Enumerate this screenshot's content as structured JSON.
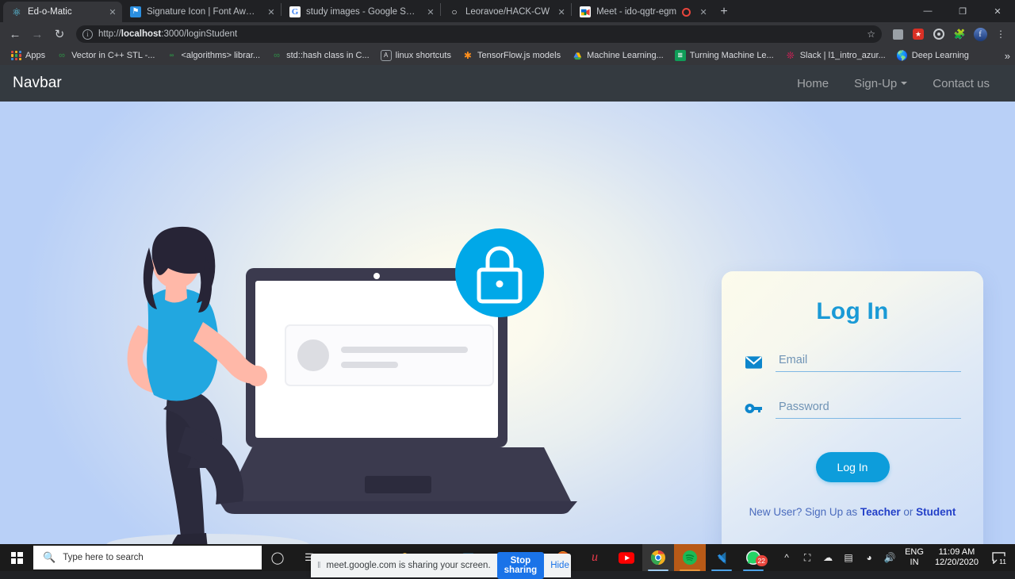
{
  "browser": {
    "tabs": [
      {
        "title": "Ed-o-Matic",
        "favicon": "react-icon",
        "active": true,
        "recording": false
      },
      {
        "title": "Signature Icon | Font Awesome",
        "favicon": "fontawesome-icon",
        "active": false,
        "recording": false
      },
      {
        "title": "study images - Google Search",
        "favicon": "google-icon",
        "active": false,
        "recording": false
      },
      {
        "title": "Leoravoe/HACK-CW",
        "favicon": "github-icon",
        "active": false,
        "recording": false
      },
      {
        "title": "Meet - ido-qgtr-egm",
        "favicon": "google-meet-icon",
        "active": false,
        "recording": true
      }
    ],
    "new_tab_label": "+",
    "close_label": "✕",
    "window_controls": {
      "minimize": "—",
      "maximize": "❐",
      "close": "✕"
    },
    "toolbar": {
      "back": "←",
      "forward": "→",
      "reload": "↻",
      "url_prefix": "http://",
      "url_host": "localhost",
      "url_rest": ":3000/loginStudent",
      "url_full": "http://localhost:3000/loginStudent",
      "bookmark_star": "☆",
      "profile_initial": "f"
    },
    "bookmarks": [
      {
        "label": "Apps",
        "icon": "apps-grid-icon"
      },
      {
        "label": "Vector in C++ STL -...",
        "icon": "geeksforgeeks-icon"
      },
      {
        "label": "<algorithms> librar...",
        "icon": "cpp-icon"
      },
      {
        "label": "std::hash class in C...",
        "icon": "geeksforgeeks-icon"
      },
      {
        "label": "linux shortcuts",
        "icon": "generic-a-icon"
      },
      {
        "label": "TensorFlow.js models",
        "icon": "tensorflow-icon"
      },
      {
        "label": "Machine Learning...",
        "icon": "drive-icon"
      },
      {
        "label": "Turning Machine Le...",
        "icon": "sheets-icon"
      },
      {
        "label": "Slack | l1_intro_azur...",
        "icon": "slack-icon"
      },
      {
        "label": "Deep Learning",
        "icon": "globe-icon"
      }
    ],
    "bookmarks_overflow": "»"
  },
  "navbar": {
    "brand": "Navbar",
    "links": [
      {
        "label": "Home",
        "has_caret": false
      },
      {
        "label": "Sign-Up",
        "has_caret": true
      },
      {
        "label": "Contact us",
        "has_caret": false
      }
    ]
  },
  "login": {
    "title": "Log In",
    "email": {
      "placeholder": "Email",
      "value": "",
      "icon": "envelope-icon"
    },
    "password": {
      "placeholder": "Password",
      "value": "",
      "icon": "key-icon"
    },
    "submit_label": "Log In",
    "signup_prefix": "New User? Sign Up as ",
    "signup_teacher": "Teacher",
    "signup_or": " or ",
    "signup_student": "Student",
    "accent_color": "#0d9ddb",
    "link_color": "#2340c8"
  },
  "illustration": {
    "name": "woman-leaning-on-laptop-with-lock",
    "lock_badge_color": "#00a8e8",
    "laptop_color": "#3b3a4e",
    "shirt_color": "#22a7e0",
    "skin_color": "#ffb8a8",
    "hair_color": "#272436"
  },
  "share_notification": {
    "grip": "‖",
    "message": "meet.google.com is sharing your screen.",
    "stop_label": "Stop sharing",
    "hide_label": "Hide",
    "stop_color": "#1a73e8"
  },
  "taskbar": {
    "start_icon": "windows-logo-icon",
    "search_placeholder": "Type here to search",
    "search_icon": "search-icon",
    "cortana_icon": "cortana-circle-icon",
    "taskview_icon": "task-view-icon",
    "pinned": [
      {
        "name": "file-explorer-icon"
      },
      {
        "name": "mail-icon"
      },
      {
        "name": "store-icon"
      },
      {
        "name": "folder-icon"
      },
      {
        "name": "excel-icon"
      },
      {
        "name": "powerpoint-icon"
      },
      {
        "name": "word-icon"
      },
      {
        "name": "firefox-icon"
      },
      {
        "name": "unacademy-icon"
      },
      {
        "name": "youtube-icon"
      },
      {
        "name": "chrome-icon"
      },
      {
        "name": "spotify-icon"
      },
      {
        "name": "vscode-icon"
      },
      {
        "name": "whatsapp-icon"
      }
    ],
    "whatsapp_badge": "22",
    "tray": {
      "show_hidden_icon": "chevron-up-icon",
      "icons": [
        "webcam-icon",
        "onedrive-icon",
        "battery-icon",
        "wifi-icon",
        "volume-icon"
      ],
      "language_line1": "ENG",
      "language_line2": "IN",
      "time": "11:09 AM",
      "date": "12/20/2020",
      "action_center_icon": "notifications-icon",
      "action_center_badge": "11"
    }
  }
}
